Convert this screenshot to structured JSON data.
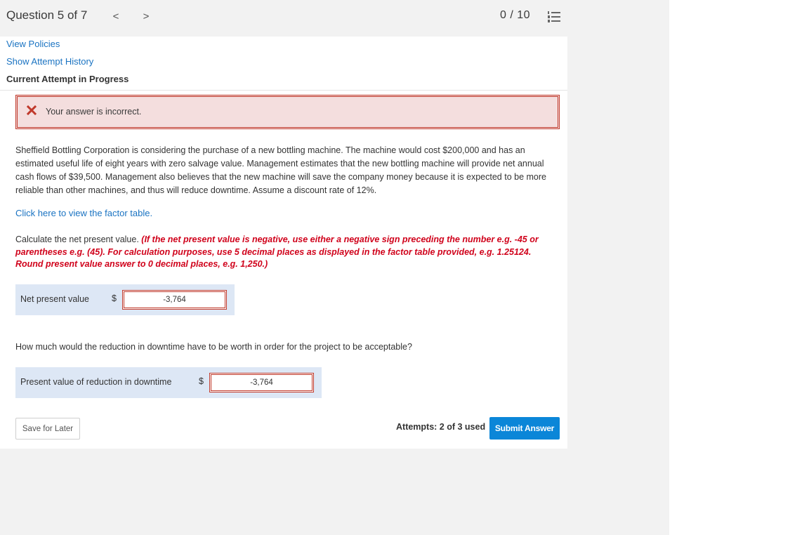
{
  "header": {
    "question_title": "Question 5 of 7",
    "prev_glyph": "<",
    "next_glyph": ">",
    "score": "0 / 10",
    "list_icon": "numbered-list-icon"
  },
  "links": {
    "view_policies": "View Policies",
    "show_attempt_history": "Show Attempt History",
    "current_attempt": "Current Attempt in Progress"
  },
  "feedback": {
    "icon": "close-icon",
    "message": "Your answer is incorrect.",
    "colors": {
      "background": "#f4dede",
      "border": "#c0392b",
      "icon": "#c0392b"
    }
  },
  "problem": {
    "text": "Sheffield Bottling Corporation is considering the purchase of a new bottling machine. The machine would cost $200,000 and has an estimated useful life of eight years with zero salvage value. Management estimates that the new bottling machine will provide net annual cash flows of $39,500. Management also believes that the new machine will save the company money because it is expected to be more reliable than other machines, and thus will reduce downtime. Assume a discount rate of 12%.",
    "factor_table_link": "Click here to view the factor table."
  },
  "instructions": {
    "prefix": "Calculate the net present value. ",
    "red_note": "(If the net present value is negative, use either a negative sign preceding the number e.g. -45 or parentheses e.g. (45). For calculation purposes, use 5 decimal places as displayed in the factor table provided, e.g. 1.25124. Round present value answer to 0 decimal places, e.g. 1,250.)"
  },
  "answer1": {
    "label": "Net present value",
    "currency": "$",
    "value": "-3,764"
  },
  "question2": "How much would the reduction in downtime have to be worth in order for the project to be acceptable?",
  "answer2": {
    "label": "Present value of reduction in downtime",
    "currency": "$",
    "value": "-3,764"
  },
  "footer": {
    "save_label": "Save for Later",
    "attempts": "Attempts: 2 of 3 used",
    "submit_label": "Submit Answer"
  },
  "colors": {
    "accent": "#0b86d8",
    "link": "#1a73c2",
    "error": "#d0021b",
    "answer_row_bg": "#dde7f5",
    "page_bg": "#f2f2f2"
  }
}
